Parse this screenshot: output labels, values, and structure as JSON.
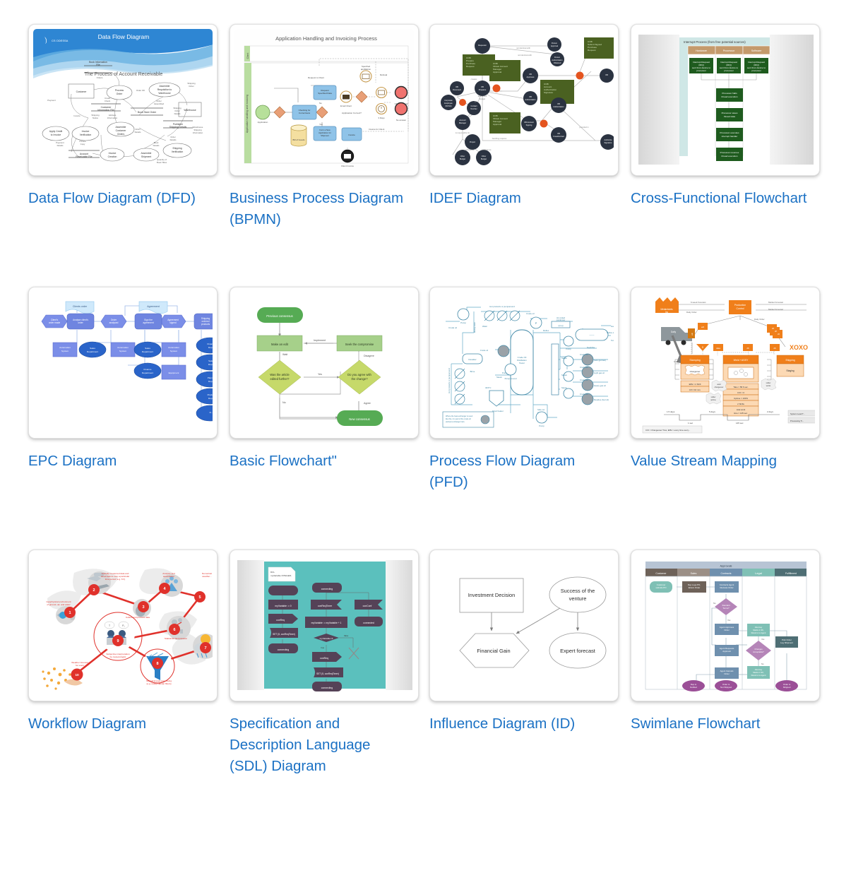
{
  "page": {
    "link_color": "#1b71c4",
    "background": "#ffffff"
  },
  "gallery": {
    "items": [
      {
        "id": "dfd",
        "caption": "Data Flow Diagram (DFD)",
        "thumb": {
          "kind": "data-flow-diagram",
          "header_title": "Data Flow Diagram",
          "logo": "CS ODESSA",
          "subtitle": "The Process of Account Receivable",
          "accent": "#2e86d3",
          "nodes": [
            "Book Information File",
            "Customer",
            "Process Order",
            "Assemble Requisition to Warehouse",
            "Warehouse",
            "Customer Information File",
            "Book Store Order",
            "Publisher Shipping Details",
            "Assemble Customer Orders",
            "Apply Credit to Invoice",
            "Invoice Verification",
            "Invoice Creation",
            "Assemble Shipment",
            "Shipping Verification",
            "Account Receivable File"
          ],
          "edge_labels": [
            "Orders",
            "Order OK",
            "Shipping Order",
            "Credit Check",
            "Order Assembled",
            "Shipping Order Details",
            "Payment",
            "Invoice",
            "Shipping Notice",
            "Address Information",
            "Order Details",
            "Warehouse Shipping Information",
            "Payment Details",
            "Invoice Copy",
            "Book Details",
            "Order Details",
            "Quantity of Book Titles"
          ]
        }
      },
      {
        "id": "bpmn",
        "caption": "Business Process Diagram (BPMN)",
        "thumb": {
          "kind": "bpmn",
          "title": "Application Handling and Invoicing Process",
          "lanes": [
            "Client",
            "Application handling and invoicing"
          ],
          "tasks": [
            "Checking for Correctness",
            "Request Specified Data",
            "Form a New Application for Shipment",
            "Invoice"
          ],
          "artifacts": [
            "Bill of Goods"
          ],
          "events": [
            "Application",
            "Email Client",
            "Specified application",
            "Client Refusal",
            "No answer",
            "Client Invoice",
            "3 Days"
          ],
          "gateway_labels": [
            "Application Correct?"
          ],
          "edge_labels": [
            "Request to Client",
            "Refusal",
            "No",
            "Yes",
            "Invoice for Client"
          ],
          "accent": "#7fb4dd"
        }
      },
      {
        "id": "idef",
        "caption": "IDEF Diagram",
        "thumb": {
          "kind": "idef",
          "node_color": "#2b3341",
          "box_color": "#4a6121",
          "junction_color": "#e4541f",
          "boxes": [
            "UOB Prepare Purchase Request",
            "UOB Submit Signed Purchase Request",
            "UOB Obtain Account Manager Approval",
            "UOB Account Authorization Signature",
            "UOB Obtain Account Manager Approval"
          ],
          "circle_labels": [
            "Requester",
            "Person Approval",
            "Person Authorization Obtained",
            "OB Document",
            "OB Prepares",
            "Corporate Employee (NCSA)",
            "Contact Number",
            "Account Manager",
            "Project",
            "Other Budget",
            "Other Budget",
            "OB Approves",
            "OB Authorization",
            "OB Account Signing",
            "OB Unauthorized",
            "Authorize Signature"
          ],
          "edge_labels": [
            "not identical with",
            "not identical with",
            "Authorized budget",
            "creates",
            "by",
            "is responsible for",
            "submits as",
            "submits as",
            "handling requires",
            "provided in"
          ]
        }
      },
      {
        "id": "cross-functional",
        "caption": "Cross-Functional Flowchart",
        "thumb": {
          "kind": "cross-functional",
          "title": "Interrupt Process (from free potential sources)",
          "columns": [
            "Hardware",
            "Processor",
            "Software"
          ],
          "header_fill": "#c49a6c",
          "box_fill": "#1e5b1e",
          "banner_fill": "#cfe7e6",
          "top_boxes": [
            "Interrupt Request (IRQ) sent from device to processor",
            "Interrupt Request (IRQ) sent from device to processor",
            "Interrupt Request (IRQ) sent from device to processor"
          ],
          "steps": [
            "Processor halts thread execution",
            "Processor saves thread state",
            "Processor executes interrupt handler",
            "Processor resumes thread execution"
          ]
        }
      },
      {
        "id": "epc",
        "caption": "EPC Diagram",
        "thumb": {
          "kind": "epc",
          "events": [
            "Client's order made",
            "Order analysed",
            "Agreement signed"
          ],
          "functions": [
            "Analyse client's order",
            "Sign the agreement",
            "Shipping ordered products"
          ],
          "documents": [
            "Clients order",
            "Agreement"
          ],
          "systems": [
            "Automation System",
            "Automation System",
            "Automation System",
            "Equipment"
          ],
          "orgs": [
            "Sales Department",
            "Sales Department",
            "Finance Department",
            "Finance Department",
            "Sales Department",
            "Planning Department",
            "Production Department"
          ],
          "accent": "#6f85e0"
        }
      },
      {
        "id": "basic-flowchart",
        "caption": "Basic Flowchart\"",
        "thumb": {
          "kind": "basic-flowchart",
          "terminators": [
            "Previous consensus",
            "New consensus"
          ],
          "processes": [
            "Make an edit",
            "Seek the compromise"
          ],
          "decisions": [
            "Was the article edited further?",
            "Do you agree with the change?"
          ],
          "edge_labels": [
            "Implement",
            "Wait",
            "Disagree",
            "Yes",
            "No",
            "Agree"
          ],
          "terminator_fill": "#56ab54",
          "process_fill": "#a6d08a",
          "decision_fill": "#c6d96a"
        }
      },
      {
        "id": "pfd",
        "caption": "Process Flow Diagram (PFD)",
        "thumb": {
          "kind": "pfd",
          "main_vessel": "Crude Oil Distillation Tower",
          "accent": "#3f87a6",
          "labels": [
            "Crude oil",
            "Pump",
            "Hot products or pumparound",
            "Crude oil",
            "Air-cooled condenser",
            "Gas",
            "Reflux",
            "Reflux drum",
            "Naphtha",
            "Steam",
            "Kero (jet fuel)",
            "Light gas oil",
            "Heavy gas oil",
            "Residue (fuel oil)",
            "Desalter",
            "Brine",
            "Pumparound",
            "Fired heater",
            "Side cut strippers",
            "Mixing valve",
            "Water",
            "Pump",
            "343°C",
            "Crude oil"
          ],
          "note": "Where the heat exchanger is used like this, it is part of the crude oil preheat exchanger train."
        }
      },
      {
        "id": "vsm",
        "caption": "Value Stream Mapping",
        "thumb": {
          "kind": "value-stream",
          "accent": "#f07f1a",
          "supplier": "Metalsheets Inc",
          "control": "Production Control",
          "customer": "XOXOX",
          "processes": [
            "Stamping",
            "Weld +Assy",
            "Shipping",
            "Staging"
          ],
          "databoxes": [
            "EPE = 2 Shift",
            "C/O = 10 min.",
            "Tako = 58.6 sec.",
            "C/O = 0",
            "Uptime = 100%",
            "2 Shifts",
            "total work time = 145 sec."
          ],
          "labels": [
            "6-week Forecast",
            "Market Forecast",
            "Market Forecast",
            "Daily Order",
            "Daily Orders",
            "Daily",
            "Coils",
            "Changeover",
            "weld changeover",
            "solder uptime",
            "solder works"
          ],
          "timeline": [
            "1.5 days",
            "1 sec",
            "5 days",
            "145 sec",
            "2 days"
          ],
          "timeline_side": [
            "System Lead Time",
            "Processing Time"
          ],
          "legend": "C/O = Changeover Time; EPE = every time every -"
        }
      },
      {
        "id": "workflow",
        "caption": "Workflow Diagram",
        "thumb": {
          "kind": "workflow",
          "accent": "#e0312b",
          "steps": [
            {
              "num": "1",
              "label": "Geophysical environment of ground, air, and water"
            },
            {
              "num": "2",
              "label": "Globally measured data and observations over a particular time period (e.g. 6 h)"
            },
            {
              "num": "3",
              "label": "Collect and process data"
            },
            {
              "num": "4",
              "label": "Analysis and assimilation"
            },
            {
              "num": "5",
              "label": "Numerical weather prediction"
            },
            {
              "num": "6",
              "label": "Statistical interpretation"
            },
            {
              "num": "7",
              "label": "Weather phenomena"
            },
            {
              "num": "8",
              "label": "Statistical post-processing (e.g. using Kalman filters)"
            },
            {
              "num": "9",
              "label": "Subjective interpretation by meteorologist"
            },
            {
              "num": "10",
              "label": "Weather forecast for users"
            }
          ]
        }
      },
      {
        "id": "sdl",
        "caption": "Specification and Description Language (SDL) Diagram",
        "thumb": {
          "kind": "sdl",
          "background": "#5bc0bd",
          "shape_fill": "#554257",
          "note": "DCL myVariable INTEGER;",
          "nodes": [
            "myVariable := 0",
            "conReq",
            "SET (5, conReqTimer)",
            "connecting",
            "connecting",
            "conReqTimer",
            "conConf",
            "myVariable := myVariable + 1",
            "connected",
            "myVariable<3",
            "conReq",
            "SET (5, conReqTimer)",
            "connecting"
          ],
          "branch_labels": [
            "false",
            "true"
          ]
        }
      },
      {
        "id": "influence",
        "caption": "Influence Diagram (ID)",
        "thumb": {
          "kind": "influence",
          "decision": "Investment Decision",
          "chance_top": "Success of the venture",
          "value": "Financial Gain",
          "chance_bottom": "Expert forecast"
        }
      },
      {
        "id": "swimlane",
        "caption": "Swimlane Flowchart",
        "thumb": {
          "kind": "swimlane",
          "title": "Approvals",
          "lanes": [
            "Customer",
            "Sales",
            "Contracts",
            "Legal",
            "Fulfillment"
          ],
          "lane_colors": [
            "#6e6259",
            "#9b8f86",
            "#6f90ae",
            "#7fc0b5",
            "#4e6e74"
          ],
          "nodes": [
            "Customer submits PO",
            "Rep Logs PO, Enters Order",
            "Contracts Agent Reviews Order",
            "Standard Terms?",
            "Agent Approves Order",
            "Attorney Marks it OK, Returns to Agent",
            "Changes Acceptable?",
            "Attorney Marks it NO, Returns to Agent",
            "Agent Requests Approval",
            "Pick Order Log Shipment",
            "Agent Cancels Order",
            "Rep is Notified",
            "Order is Not Shipped",
            "Order is Shipped"
          ],
          "edge_labels": [
            "No",
            "Yes",
            "Yes",
            "No"
          ]
        }
      }
    ]
  }
}
